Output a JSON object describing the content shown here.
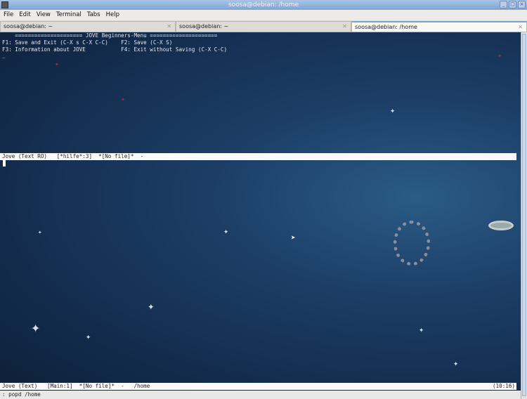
{
  "window": {
    "title": "soosa@debian: /home"
  },
  "menu": [
    "File",
    "Edit",
    "View",
    "Terminal",
    "Tabs",
    "Help"
  ],
  "tabs": [
    {
      "label": "soosa@debian: ~"
    },
    {
      "label": "soosa@debian: ~"
    },
    {
      "label": "soosa@debian: /home"
    }
  ],
  "terminal": {
    "lines": [
      "    ===================== JOVE Beginners-Menu =====================",
      "F1: Save and Exit (C-X s C-X C-C)    F2: Save (C-X S)",
      "F3: Information about JOVE           F4: Exit without Saving (C-X C-C)",
      "_"
    ],
    "top_mode_line": "Jove (Text RO)   [*hilfe*:3]  *[No file]*  -",
    "bottom_mode_line": "Jove (Text)   [Main:1]  *[No file]*  -   /home",
    "clock": "(10:16)",
    "minibuffer": ": popd /home"
  }
}
